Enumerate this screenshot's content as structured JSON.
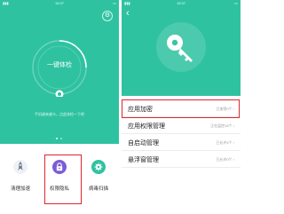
{
  "left_screen": {
    "status": {
      "time": "15:37",
      "signal": "▮▮▮",
      "battery": "▭"
    },
    "gear_icon": "gear-icon",
    "checkup_label": "一键体检",
    "hint": "手机越来越卡，点此体检一下吧",
    "tiles": [
      {
        "label": "清理加速",
        "icon": "rocket-icon",
        "color": "#e9eef3"
      },
      {
        "label": "权限隐私",
        "icon": "lock-icon",
        "color": "#7b5cd6"
      },
      {
        "label": "病毒扫描",
        "icon": "shield-icon",
        "color": "#2fc2a1"
      }
    ]
  },
  "right_screen": {
    "status": {
      "time": "15:37",
      "signal": "▮▮▮",
      "battery": "▭"
    },
    "back_icon": "back-arrow-icon",
    "hero_icon": "key-icon",
    "rows": [
      {
        "title": "应用加密",
        "status": "已加密0个 ›"
      },
      {
        "title": "应用权限管理",
        "status": "正在监控18个 ›"
      },
      {
        "title": "自启动管理",
        "status": "已允许4个 ›"
      },
      {
        "title": "悬浮窗管理",
        "status": "已允许0个 ›"
      }
    ]
  },
  "colors": {
    "accent": "#2fc2a1",
    "highlight": "#e0252b",
    "privacy": "#7b5cd6"
  }
}
